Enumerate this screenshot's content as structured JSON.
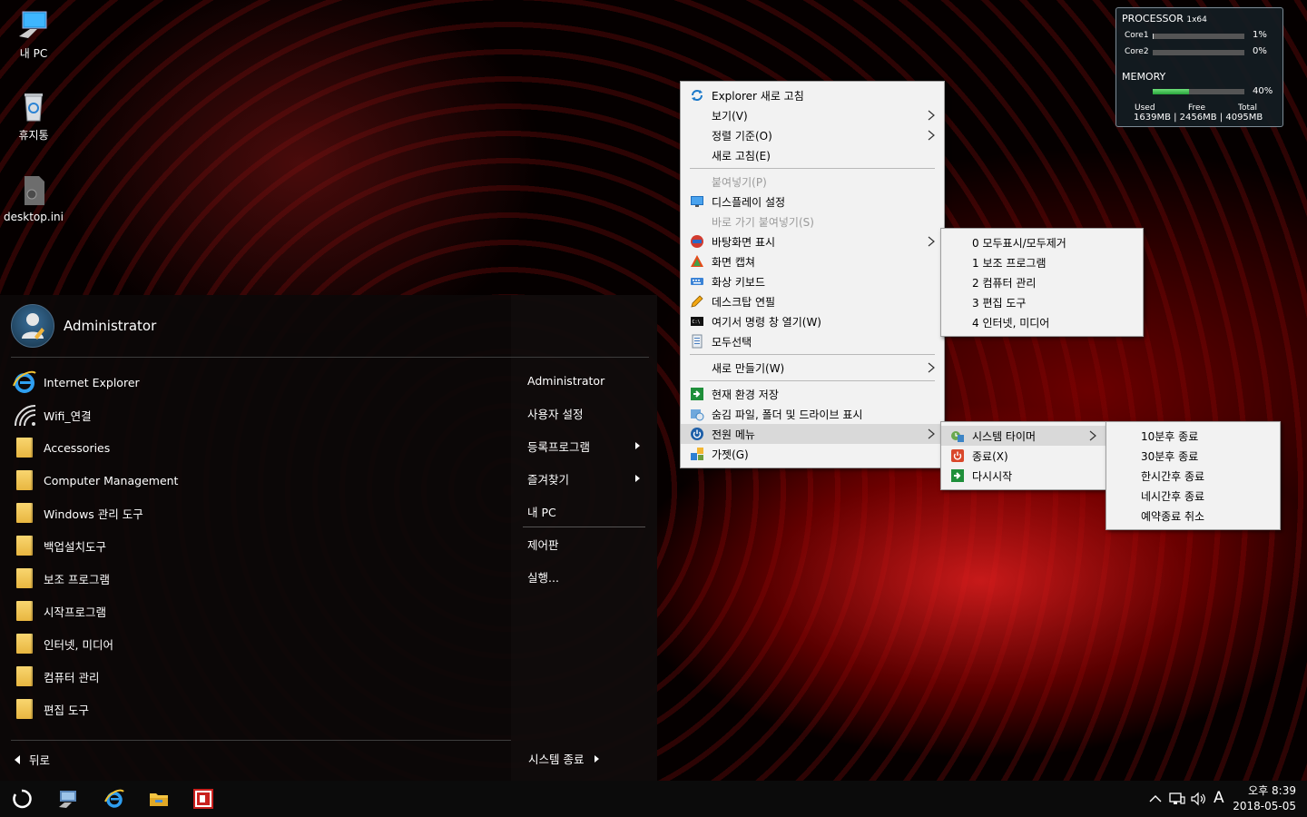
{
  "desktop": {
    "icons": [
      {
        "label": "내 PC",
        "icon": "monitor-icon"
      },
      {
        "label": "휴지통",
        "icon": "recycle-bin-icon"
      },
      {
        "label": "desktop.ini",
        "icon": "ini-file-icon"
      }
    ]
  },
  "start_menu": {
    "user_name": "Administrator",
    "programs": [
      {
        "label": "Internet Explorer",
        "icon": "internet-explorer-icon"
      },
      {
        "label": "Wifi_연결",
        "icon": "wifi-icon"
      },
      {
        "label": "Accessories",
        "icon": "folder-icon"
      },
      {
        "label": "Computer Management",
        "icon": "folder-icon"
      },
      {
        "label": "Windows 관리 도구",
        "icon": "folder-icon"
      },
      {
        "label": "백업설치도구",
        "icon": "folder-icon"
      },
      {
        "label": "보조 프로그램",
        "icon": "folder-icon"
      },
      {
        "label": "시작프로그램",
        "icon": "folder-icon"
      },
      {
        "label": "인터넷, 미디어",
        "icon": "folder-icon"
      },
      {
        "label": "컴퓨터 관리",
        "icon": "folder-icon"
      },
      {
        "label": "편집 도구",
        "icon": "folder-icon"
      }
    ],
    "right_items": [
      {
        "label": "Administrator"
      },
      {
        "label": "사용자 설정"
      },
      {
        "label": "등록프로그램"
      },
      {
        "label": "즐겨찾기"
      },
      {
        "label": "내 PC"
      },
      {
        "label": "제어판"
      },
      {
        "label": "실행..."
      }
    ],
    "back_label": "뒤로",
    "shutdown_label": "시스템 종료"
  },
  "context_menu": {
    "items": [
      {
        "label": "Explorer 새로 고침",
        "icon": "refresh-icon"
      },
      {
        "label": "보기(V)"
      },
      {
        "label": "정렬 기준(O)"
      },
      {
        "label": "새로 고침(E)"
      },
      {
        "label": "붙여넣기(P)"
      },
      {
        "label": "디스플레이 설정",
        "icon": "display-icon"
      },
      {
        "label": "바로 가기 붙여넣기(S)"
      },
      {
        "label": "바탕화면 표시",
        "icon": "show-desktop-icon"
      },
      {
        "label": "화면 캡쳐",
        "icon": "screen-capture-icon"
      },
      {
        "label": "화상 키보드",
        "icon": "keyboard-icon"
      },
      {
        "label": "데스크탑 연필",
        "icon": "pencil-icon"
      },
      {
        "label": "여기서 명령 창 열기(W)",
        "icon": "command-prompt-icon"
      },
      {
        "label": "모두선택",
        "icon": "select-all-icon"
      },
      {
        "label": "새로 만들기(W)"
      },
      {
        "label": "현재 환경 저장",
        "icon": "save-arrow-icon"
      },
      {
        "label": "숨김 파일, 폴더 및 드라이브 표시",
        "icon": "hidden-files-icon"
      },
      {
        "label": "전원 메뉴",
        "icon": "power-icon"
      },
      {
        "label": "가젯(G)",
        "icon": "gadget-icon"
      }
    ]
  },
  "show_desktop_submenu": {
    "items": [
      {
        "label": "0 모두표시/모두제거"
      },
      {
        "label": "1 보조 프로그램"
      },
      {
        "label": "2 컴퓨터 관리"
      },
      {
        "label": "3 편집 도구"
      },
      {
        "label": "4 인터넷, 미디어"
      }
    ]
  },
  "power_submenu": {
    "items": [
      {
        "label": "시스템 타이머",
        "icon": "system-timer-icon"
      },
      {
        "label": "종료(X)",
        "icon": "shutdown-icon"
      },
      {
        "label": "다시시작",
        "icon": "restart-icon"
      }
    ]
  },
  "timer_submenu": {
    "items": [
      {
        "label": "10분후 종료"
      },
      {
        "label": "30분후 종료"
      },
      {
        "label": "한시간후 종료"
      },
      {
        "label": "네시간후 종료"
      },
      {
        "label": "예약종료 취소"
      }
    ]
  },
  "gadget": {
    "processor_title": "PROCESSOR",
    "processor_sub": "1x64",
    "cores": [
      {
        "name": "Core1",
        "percent": "1%",
        "value": 1
      },
      {
        "name": "Core2",
        "percent": "0%",
        "value": 0
      }
    ],
    "memory_title": "MEMORY",
    "memory_percent": "40%",
    "memory_value": 40,
    "used_label": "Used",
    "used_value": "1639MB",
    "free_label": "Free",
    "free_value": "2456MB",
    "total_label": "Total",
    "total_value": "4095MB"
  },
  "taskbar": {
    "apps": [
      "start-spinner-icon",
      "computer-icon",
      "internet-explorer-icon",
      "file-explorer-icon",
      "red-app-icon"
    ],
    "ime": "A",
    "time": "오후 8:39",
    "date": "2018-05-05"
  }
}
